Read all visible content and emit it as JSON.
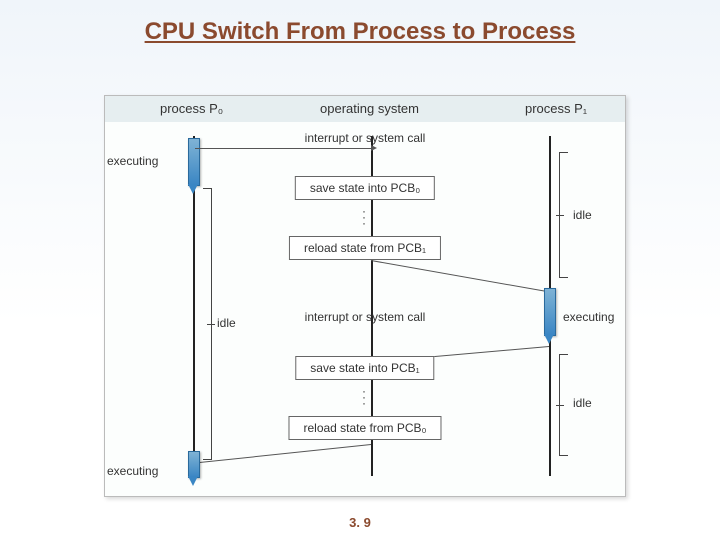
{
  "title": "CPU Switch From Process to Process",
  "slide_number": "3. 9",
  "diagram": {
    "columns": {
      "p0": "process P₀",
      "os": "operating system",
      "p1": "process P₁"
    },
    "events": {
      "interrupt1": "interrupt or system call",
      "save_pcb0": "save state into PCB₀",
      "reload_pcb1": "reload state from PCB₁",
      "interrupt2": "interrupt or system call",
      "save_pcb1": "save state into PCB₁",
      "reload_pcb0": "reload state from PCB₀"
    },
    "labels": {
      "executing": "executing",
      "idle": "idle"
    }
  }
}
